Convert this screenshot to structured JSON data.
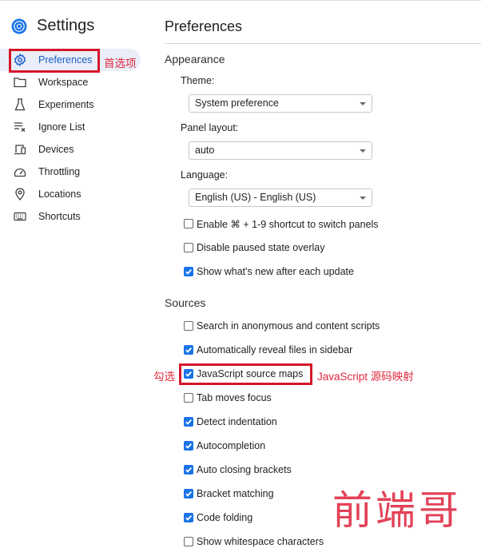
{
  "sidebar": {
    "title": "Settings",
    "items": [
      {
        "label": "Preferences",
        "icon": "gear-icon",
        "selected": true
      },
      {
        "label": "Workspace",
        "icon": "folder-icon"
      },
      {
        "label": "Experiments",
        "icon": "flask-icon"
      },
      {
        "label": "Ignore List",
        "icon": "ignore-list-icon"
      },
      {
        "label": "Devices",
        "icon": "devices-icon"
      },
      {
        "label": "Throttling",
        "icon": "speedometer-icon"
      },
      {
        "label": "Locations",
        "icon": "location-pin-icon"
      },
      {
        "label": "Shortcuts",
        "icon": "keyboard-icon"
      }
    ]
  },
  "main": {
    "title": "Preferences",
    "appearance": {
      "title": "Appearance",
      "theme": {
        "label": "Theme:",
        "value": "System preference"
      },
      "panel_layout": {
        "label": "Panel layout:",
        "value": "auto"
      },
      "language": {
        "label": "Language:",
        "value": "English (US) - English (US)"
      },
      "checkboxes": [
        {
          "label": "Enable ⌘ + 1-9 shortcut to switch panels",
          "checked": false
        },
        {
          "label": "Disable paused state overlay",
          "checked": false
        },
        {
          "label": "Show what's new after each update",
          "checked": true
        }
      ]
    },
    "sources": {
      "title": "Sources",
      "checkboxes": [
        {
          "label": "Search in anonymous and content scripts",
          "checked": false
        },
        {
          "label": "Automatically reveal files in sidebar",
          "checked": true
        },
        {
          "label": "JavaScript source maps",
          "checked": true
        },
        {
          "label": "Tab moves focus",
          "checked": false
        },
        {
          "label": "Detect indentation",
          "checked": true
        },
        {
          "label": "Autocompletion",
          "checked": true
        },
        {
          "label": "Auto closing brackets",
          "checked": true
        },
        {
          "label": "Bracket matching",
          "checked": true
        },
        {
          "label": "Code folding",
          "checked": true
        },
        {
          "label": "Show whitespace characters",
          "checked": false
        }
      ]
    }
  },
  "annotations": {
    "preferences_note": "首选项",
    "check_note": "勾选",
    "sourcemap_note": "JavaScript 源码映射",
    "watermark": "前端哥"
  },
  "colors": {
    "accent": "#1a73e8",
    "selected_text": "#1a5fc8",
    "annotation_red": "#d5152a"
  }
}
